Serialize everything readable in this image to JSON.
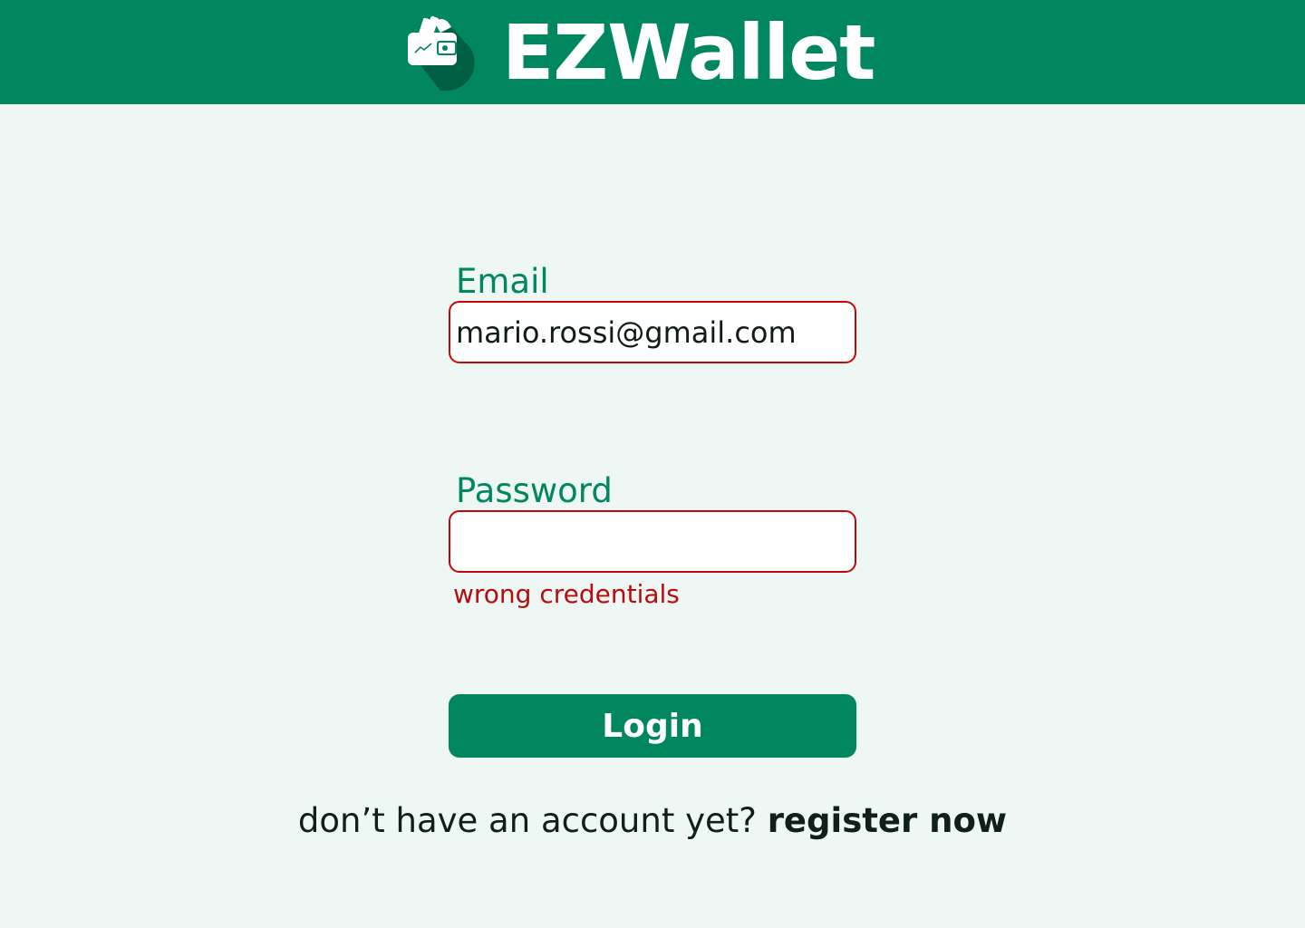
{
  "header": {
    "app_title": "EZWallet",
    "logo_icon": "wallet-icon",
    "background_color": "#00875F"
  },
  "login_form": {
    "email": {
      "label": "Email",
      "value": "mario.rossi@gmail.com",
      "state": "error"
    },
    "password": {
      "label": "Password",
      "value": "",
      "state": "error"
    },
    "error_message": "wrong credentials",
    "login_button_label": "Login"
  },
  "register": {
    "prompt_text": "don’t have an account yet?",
    "link_text": "register now"
  },
  "colors": {
    "accent": "#00875F",
    "error": "#C00808",
    "background": "#EEF7F4"
  }
}
